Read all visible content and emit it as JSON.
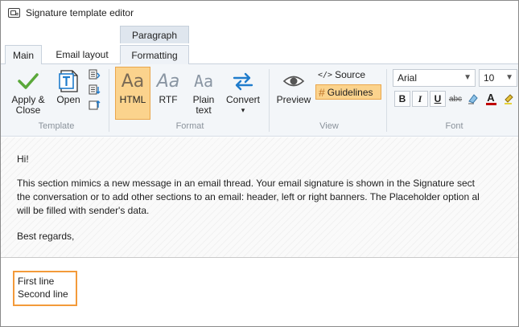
{
  "window": {
    "title": "Signature template editor"
  },
  "context_group": {
    "label": "Paragraph"
  },
  "tabs": [
    {
      "label": "Main"
    },
    {
      "label": "Email layout"
    },
    {
      "label": "Formatting"
    }
  ],
  "ribbon": {
    "template": {
      "group_label": "Template",
      "apply_close_line1": "Apply &",
      "apply_close_line2": "Close",
      "open": "Open"
    },
    "format": {
      "group_label": "Format",
      "html_glyph": "Aa",
      "html": "HTML",
      "rtf_glyph": "Aa",
      "rtf": "RTF",
      "plain_glyph": "Aa",
      "plain_line1": "Plain",
      "plain_line2": "text",
      "convert": "Convert",
      "convert_arrow": "▾"
    },
    "view": {
      "group_label": "View",
      "preview": "Preview",
      "source_glyph": "</>",
      "source": "Source",
      "guidelines_glyph": "#",
      "guidelines": "Guidelines"
    },
    "font": {
      "group_label": "Font",
      "font_name": "Arial",
      "font_size": "10",
      "bold": "B",
      "italic": "I",
      "underline": "U",
      "strike": "abc",
      "font_color_glyph": "A"
    }
  },
  "content": {
    "greeting": "Hi!",
    "line1": "This section mimics a new message in an email thread. Your email signature is shown in the Signature sect",
    "line2": "the conversation or to add other sections to an email: header, left or right banners. The Placeholder option al",
    "line3": "will be filled with sender's data.",
    "closing": "Best regards,"
  },
  "signature": {
    "line1": "First line",
    "line2": "Second line"
  },
  "colors": {
    "accent_orange": "#f39a3a",
    "selected_fill": "#fbd38d",
    "check_green": "#5aa83a",
    "blue_icon": "#1f7ccc"
  }
}
